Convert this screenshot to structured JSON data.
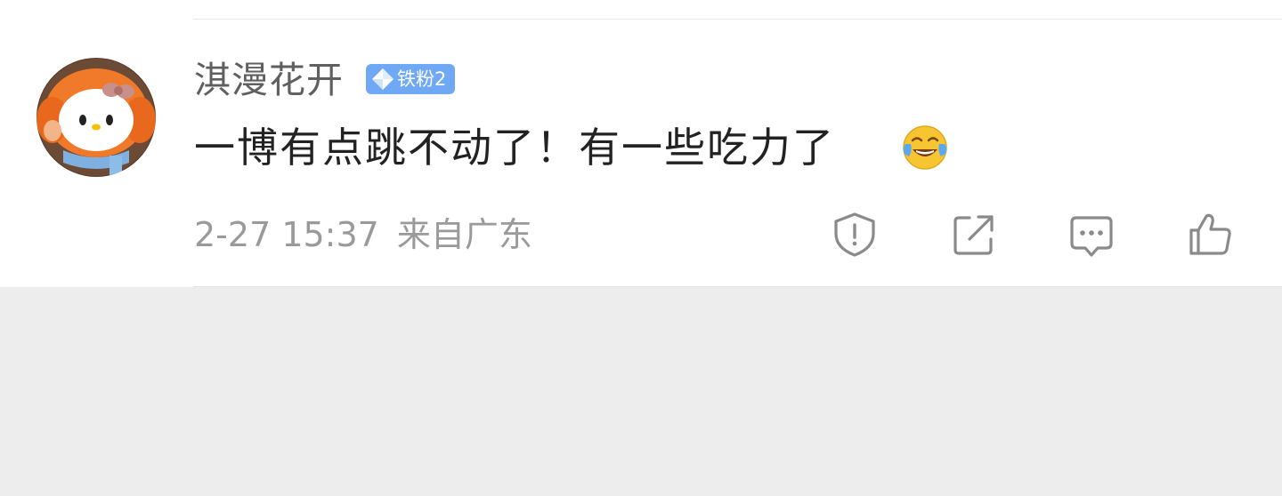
{
  "comment": {
    "username": "淇漫花开",
    "badge_label": "铁粉2",
    "text": "一博有点跳不动了！有一些吃力了",
    "emoji": "laughing-tears-emoji",
    "timestamp": "2-27 15:37",
    "location": "来自广东"
  },
  "actions": [
    {
      "name": "report",
      "icon": "shield-exclamation-icon"
    },
    {
      "name": "share",
      "icon": "share-arrow-icon"
    },
    {
      "name": "comment",
      "icon": "speech-bubble-icon"
    },
    {
      "name": "like",
      "icon": "thumbs-up-icon"
    }
  ],
  "colors": {
    "badge": "#6fa8f5",
    "username": "#5f5f5f",
    "text": "#222222",
    "meta": "#9a9a9a",
    "icon": "#8a8a8a",
    "background": "#ededed"
  }
}
